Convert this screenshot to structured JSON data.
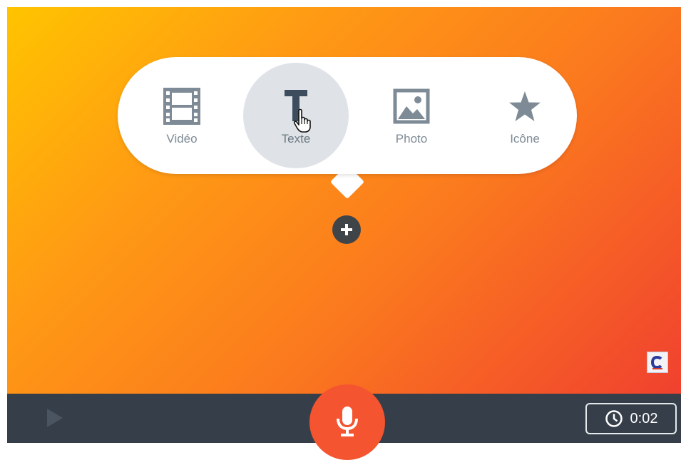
{
  "insert_menu": {
    "options": [
      {
        "label": "Vidéo",
        "icon": "film-icon"
      },
      {
        "label": "Texte",
        "icon": "text-t-icon"
      },
      {
        "label": "Photo",
        "icon": "photo-icon"
      },
      {
        "label": "Icône",
        "icon": "star-icon"
      }
    ],
    "hovered_option": "Texte"
  },
  "add_button": {
    "icon": "plus-icon"
  },
  "toolbar": {
    "play_icon": "play-icon",
    "record_icon": "microphone-icon",
    "timer": {
      "icon": "clock-icon",
      "value": "0:02"
    }
  },
  "colors": {
    "background_gradient": [
      "#ffc400",
      "#ff9a14",
      "#f0412f"
    ],
    "toolbar": "#363f49",
    "record_button": "#f4542f",
    "icon_tint": "#7e8b96",
    "hover_circle": "#dfe3e7"
  }
}
